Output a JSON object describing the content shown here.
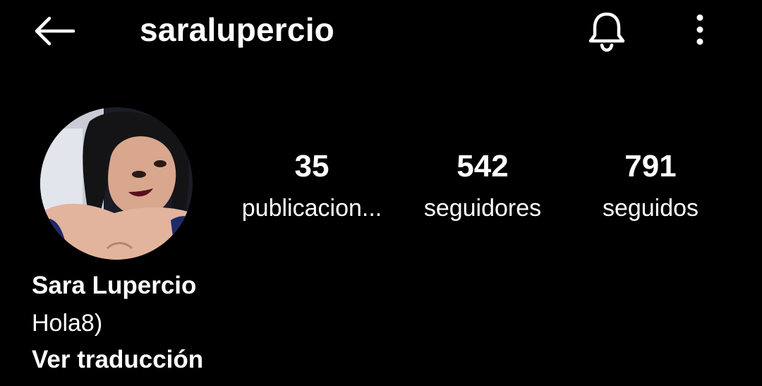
{
  "header": {
    "username": "saralupercio",
    "back_icon": "arrow-left-icon",
    "notifications_icon": "bell-icon",
    "more_icon": "vertical-dots-icon"
  },
  "profile": {
    "avatar_alt": "Sara Lupercio profile photo",
    "stats": [
      {
        "value": "35",
        "label": "publicacion..."
      },
      {
        "value": "542",
        "label": "seguidores"
      },
      {
        "value": "791",
        "label": "seguidos"
      }
    ],
    "display_name": "Sara Lupercio",
    "bio": "Hola8)",
    "translate_label": "Ver traducción"
  },
  "colors": {
    "background": "#000000",
    "text": "#ffffff"
  }
}
